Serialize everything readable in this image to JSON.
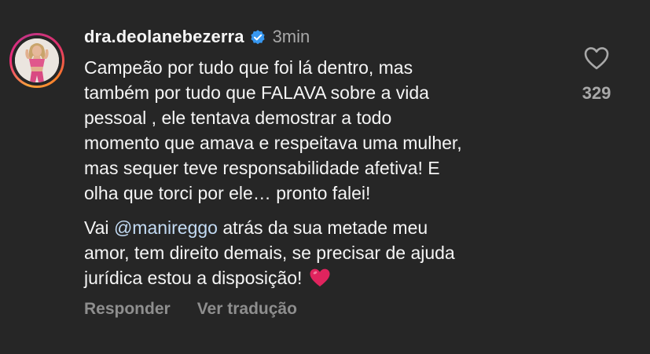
{
  "colors": {
    "background": "#262626",
    "text_primary": "#f5f5f5",
    "text_secondary": "#a8a8a8",
    "action_text": "#8e8e8e",
    "verified_badge": "#3797f0",
    "heart_emoji": "#e0245e"
  },
  "comment": {
    "username": "dra.deolanebezerra",
    "verified_icon": "verified-badge-icon",
    "timestamp": "3min",
    "paragraph1": "Campeão por tudo que foi lá dentro, mas\ntambém por tudo que FALAVA sobre a vida\npessoal , ele tentava  demostrar a todo\nmomento que amava e respeitava uma mulher,\nmas sequer teve responsabilidade afetiva! E\nolha que torci por ele… pronto falei!",
    "paragraph2_before": "Vai ",
    "mention": "@manireggo",
    "paragraph2_after": " atrás da sua metade meu\namor, tem direito demais, se precisar de ajuda\njurídica estou a disposição! ",
    "emoji": "red-heart-emoji"
  },
  "actions": {
    "reply_label": "Responder",
    "translate_label": "Ver tradução"
  },
  "like": {
    "icon": "heart-outline-icon",
    "count": "329"
  }
}
